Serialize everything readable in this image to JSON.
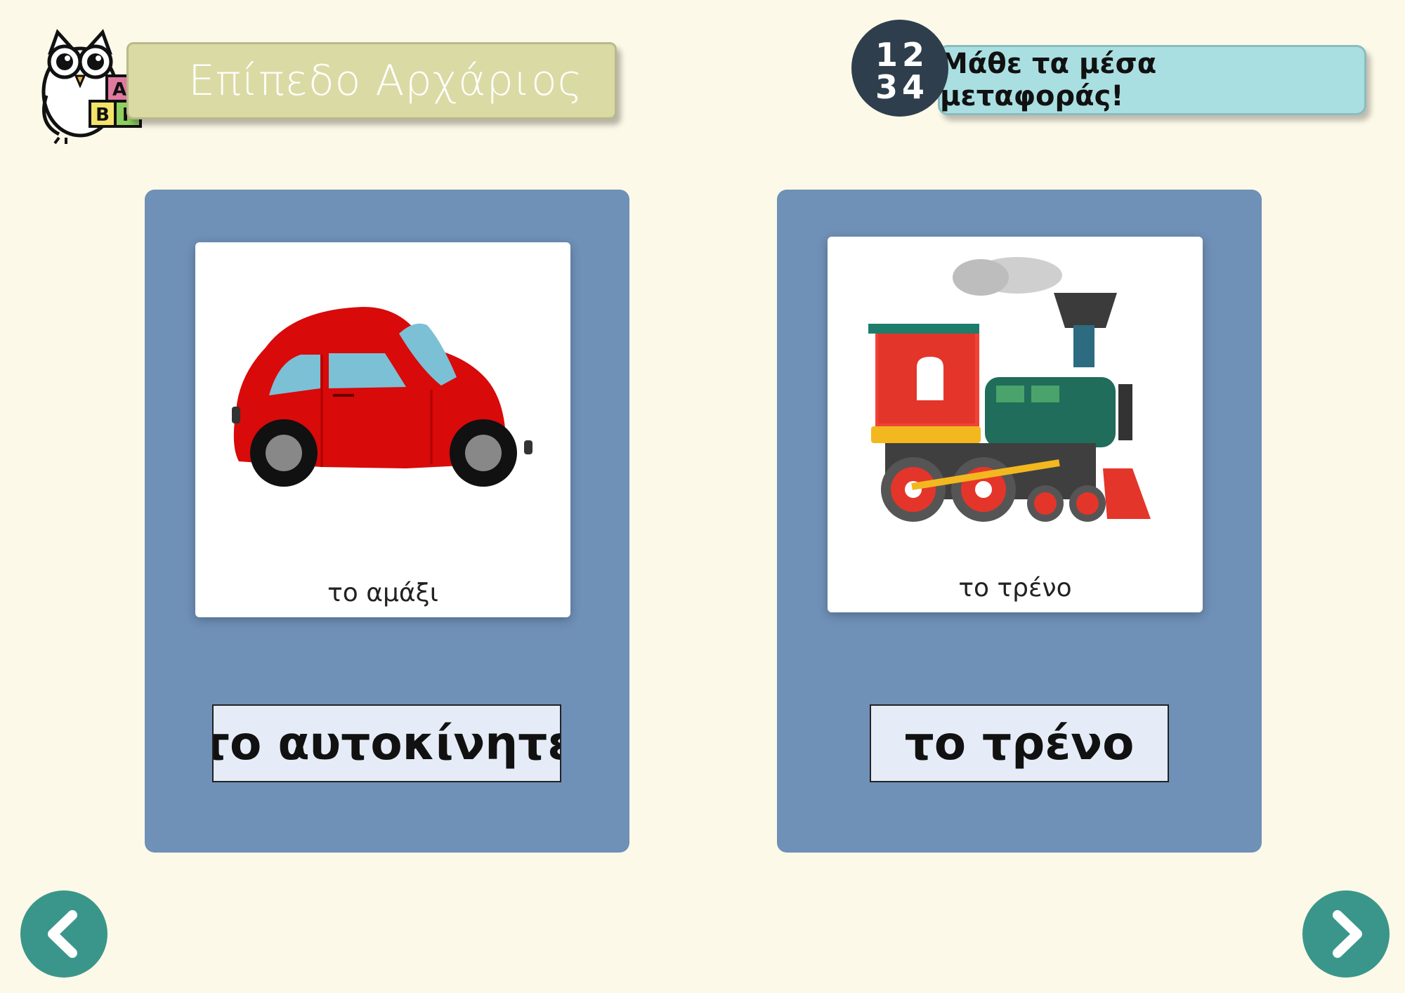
{
  "header": {
    "level_label": "Επίπεδο Αρχάριος",
    "title": "Μάθε τα μέσα μεταφοράς!",
    "badge_numbers": [
      "1",
      "2",
      "3",
      "4"
    ],
    "logo_letters": [
      "Α",
      "Β",
      "Γ"
    ]
  },
  "cards": [
    {
      "caption": "το αμάξι",
      "word": "το αυτοκίνητε",
      "illustration": "red-car"
    },
    {
      "caption": "το τρένο",
      "word": "το τρένο",
      "illustration": "steam-train"
    }
  ],
  "navigation": {
    "prev_icon": "chevron-left-icon",
    "next_icon": "chevron-right-icon"
  },
  "colors": {
    "background": "#fdf9e8",
    "card": "#6f90b7",
    "level_banner": "#dadaa4",
    "title_banner": "#aadfe2",
    "nav_button": "#3a968a"
  }
}
